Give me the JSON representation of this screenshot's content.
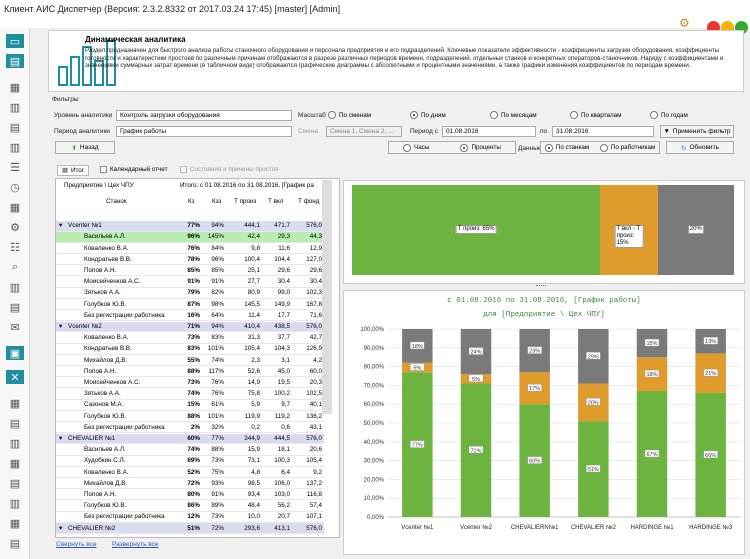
{
  "window": {
    "title": "Клиент АИС Диспетчер (Версия: 2.3.2.8332 от 2017.03.24 17:45) [master] [Admin]"
  },
  "info": {
    "title": "Динамическая аналитика",
    "text": "Раздел предназначен для быстрого анализа работы станочного оборудования и персонала предприятия и его подразделений. Ключевые показатели эффективности - коэффициенты загрузки оборудования, коэффициенты готовности и характеристики простоев по различным причинам отображаются в разрезе различных периодов времени, подразделений, отдельных станков и конкретных операторов-станочников. Наряду с коэффициентами и значениями суммарных затрат времени (в табличном виде) отображаются графические диаграммы с абсолютными и процентными значениями, а также графики изменения коэффициентов по периодам времени."
  },
  "filters": {
    "group_label": "Фильтры",
    "level_label": "Уровень аналитики",
    "level_value": "Контроль загрузки оборудования",
    "period_label": "Период аналитики",
    "period_value": "График работы",
    "shifts_label": "Смена",
    "shifts_value": "Смена 1, Смена 2, ...",
    "scale_label": "Масштаб",
    "scales": [
      "По сменам",
      "По дням",
      "По месяцам",
      "По кварталам",
      "По годам"
    ],
    "from_label": "Период с",
    "from_value": "01.08.2016",
    "to_label": "по",
    "to_value": "31.08.2016",
    "apply": "Применить фильтр",
    "back": "Назад",
    "hours": "Часы",
    "percent": "Проценты",
    "data_label": "Данные:",
    "by_machine": "По станкам",
    "by_worker": "По работникам",
    "refresh": "Обновить"
  },
  "tabs": {
    "total": "Итог",
    "calendar": "Календарный отчет",
    "states": "Состояния и причины простоя"
  },
  "grid": {
    "header_left": "Предприятие \\ Цех ЧПУ",
    "header_right": "Итого: с 01.08.2016 по 31.08.2016, [График ра",
    "columns": [
      "Станок",
      "Кз",
      "Кзз",
      "Т произ",
      "Т вкл",
      "Т фонд"
    ],
    "rows": [
      {
        "name": "Vcenter №1",
        "kz": "77%",
        "kzz": "94%",
        "tp": "444,1",
        "tv": "471,7",
        "tf": "576,0",
        "type": "grp"
      },
      {
        "name": "Васильев А.Л.",
        "kz": "96%",
        "kzz": "145%",
        "tp": "42,4",
        "tv": "29,3",
        "tf": "44,3",
        "type": "hl"
      },
      {
        "name": "Коваленко В.А.",
        "kz": "76%",
        "kzz": "84%",
        "tp": "9,8",
        "tv": "11,6",
        "tf": "12,9",
        "type": ""
      },
      {
        "name": "Кондратьев В.В.",
        "kz": "78%",
        "kzz": "96%",
        "tp": "100,4",
        "tv": "104,4",
        "tf": "127,0",
        "type": ""
      },
      {
        "name": "Попов А.Н.",
        "kz": "85%",
        "kzz": "85%",
        "tp": "25,1",
        "tf": "29,6",
        "tv": "29,6",
        "type": ""
      },
      {
        "name": "Моисейченков А.С.",
        "kz": "91%",
        "kzz": "91%",
        "tp": "27,7",
        "tv": "30,4",
        "tf": "30,4",
        "type": ""
      },
      {
        "name": "Зятьков А.А.",
        "kz": "79%",
        "kzz": "82%",
        "tp": "80,9",
        "tv": "99,0",
        "tf": "102,3",
        "type": ""
      },
      {
        "name": "Голубков Ю.В.",
        "kz": "87%",
        "kzz": "98%",
        "tp": "145,5",
        "tv": "149,9",
        "tf": "167,8",
        "type": ""
      },
      {
        "name": "Без регистрации работника",
        "kz": "16%",
        "kzz": "64%",
        "tp": "11,4",
        "tv": "17,7",
        "tf": "71,6",
        "type": ""
      },
      {
        "name": "Vcenter №2",
        "kz": "71%",
        "kzz": "94%",
        "tp": "410,4",
        "tv": "438,5",
        "tf": "576,0",
        "type": "grp"
      },
      {
        "name": "Коваленко В.А.",
        "kz": "73%",
        "kzz": "83%",
        "tp": "31,3",
        "tv": "37,7",
        "tf": "42,7",
        "type": ""
      },
      {
        "name": "Кондратьев В.В.",
        "kz": "83%",
        "kzz": "101%",
        "tp": "105,4",
        "tv": "104,3",
        "tf": "126,9",
        "type": ""
      },
      {
        "name": "Михайлов Д.В.",
        "kz": "55%",
        "kzz": "74%",
        "tp": "2,3",
        "tv": "3,1",
        "tf": "4,2",
        "type": ""
      },
      {
        "name": "Попов А.Н.",
        "kz": "88%",
        "kzz": "117%",
        "tp": "52,6",
        "tv": "45,0",
        "tf": "60,0",
        "type": ""
      },
      {
        "name": "Моисейченков А.С.",
        "kz": "73%",
        "kzz": "76%",
        "tp": "14,9",
        "tv": "19,5",
        "tf": "20,3",
        "type": ""
      },
      {
        "name": "Зятьков А.А.",
        "kz": "74%",
        "kzz": "76%",
        "tp": "75,8",
        "tv": "100,2",
        "tf": "102,5",
        "type": ""
      },
      {
        "name": "Сазонов М.А.",
        "kz": "15%",
        "kzz": "61%",
        "tp": "5,9",
        "tv": "9,7",
        "tf": "40,1",
        "type": ""
      },
      {
        "name": "Голубков Ю.В.",
        "kz": "88%",
        "kzz": "101%",
        "tp": "119,9",
        "tv": "119,2",
        "tf": "136,2",
        "type": ""
      },
      {
        "name": "Без регистрации работника",
        "kz": "2%",
        "kzz": "32%",
        "tp": "0,2",
        "tv": "0,6",
        "tf": "43,1",
        "type": ""
      },
      {
        "name": "CHEVALIER №1",
        "kz": "60%",
        "kzz": "77%",
        "tp": "344,9",
        "tv": "444,5",
        "tf": "576,0",
        "type": "grp"
      },
      {
        "name": "Васильев А.Л.",
        "kz": "74%",
        "kzz": "88%",
        "tp": "15,9",
        "tv": "18,1",
        "tf": "20,6",
        "type": ""
      },
      {
        "name": "Худобкин С.Л.",
        "kz": "69%",
        "kzz": "73%",
        "tp": "73,1",
        "tv": "100,3",
        "tf": "105,4",
        "type": ""
      },
      {
        "name": "Коваленко В.А.",
        "kz": "52%",
        "kzz": "75%",
        "tp": "4,8",
        "tv": "6,4",
        "tf": "9,2",
        "type": ""
      },
      {
        "name": "Михайлов Д.В.",
        "kz": "72%",
        "kzz": "93%",
        "tp": "98,5",
        "tv": "106,0",
        "tf": "137,2",
        "type": ""
      },
      {
        "name": "Попов А.Н.",
        "kz": "80%",
        "kzz": "91%",
        "tp": "93,4",
        "tv": "103,0",
        "tf": "116,8",
        "type": ""
      },
      {
        "name": "Голубков Ю.В.",
        "kz": "86%",
        "kzz": "89%",
        "tp": "48,4",
        "tv": "56,2",
        "tf": "57,4",
        "type": ""
      },
      {
        "name": "Без регистрации работника",
        "kz": "12%",
        "kzz": "73%",
        "tp": "10,0",
        "tv": "20,7",
        "tf": "107,1",
        "type": ""
      },
      {
        "name": "CHEVALIER №2",
        "kz": "51%",
        "kzz": "72%",
        "tp": "293,6",
        "tv": "413,1",
        "tf": "576,0",
        "type": "grp"
      }
    ],
    "collapse": "Свернуть все",
    "expand": "Развернуть все"
  },
  "summary_bar": {
    "segments": [
      {
        "label": "Т произ: 65%",
        "value": 65,
        "color": "#6db33f"
      },
      {
        "label": "Т вкл - Т произ: 15%",
        "value": 15,
        "color": "#e09b2d"
      },
      {
        "label": "20%",
        "value": 20,
        "color": "#7a7a7a"
      }
    ]
  },
  "chart_data": {
    "type": "bar",
    "title": "с 01.08.2016 по 31.08.2016, [График работы]",
    "subtitle": "для [Предприятие \\ Цех ЧПУ]",
    "categories": [
      "Vcenter №1",
      "Vcenter №2",
      "CHEVALIERN№1",
      "CHEVALIER №2",
      "HARDINGE №1",
      "HARDINGE №3"
    ],
    "ylim": [
      0,
      100
    ],
    "yticks": [
      "0,00%",
      "10,00%",
      "20,00%",
      "30,00%",
      "40,00%",
      "50,00%",
      "60,00%",
      "70,00%",
      "80,00%",
      "90,00%",
      "100,00%"
    ],
    "series": [
      {
        "values": [
          77,
          71,
          60,
          51,
          67,
          66
        ],
        "color": "#6db33f"
      },
      {
        "values": [
          5,
          5,
          17,
          20,
          18,
          21
        ],
        "color": "#e09b2d"
      },
      {
        "values": [
          18,
          24,
          23,
          29,
          15,
          13
        ],
        "color": "#7a7a7a"
      }
    ]
  }
}
